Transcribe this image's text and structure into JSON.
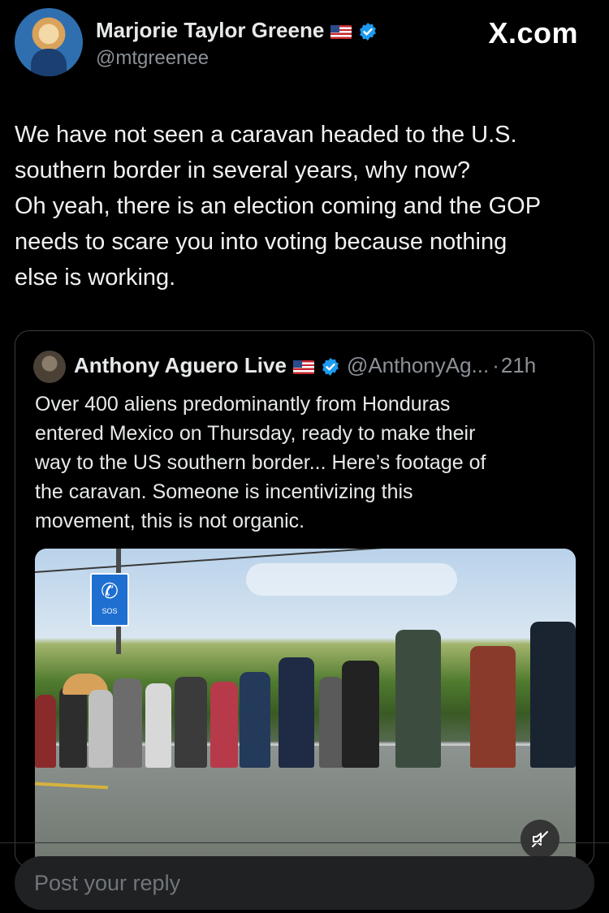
{
  "post": {
    "author_name": "Marjorie Taylor Greene",
    "handle": "@mtgreenee",
    "brand": "X.com",
    "text_lines": [
      "We have not seen a caravan headed to the U.S.",
      "southern border in several years, why now?",
      "Oh yeah, there is an election coming and the GOP",
      "needs to scare you into voting because nothing",
      "else is working."
    ]
  },
  "quote": {
    "author_name": "Anthony Aguero Live",
    "handle": "@AnthonyAg...",
    "separator": "·",
    "time": "21h",
    "text_lines": [
      "Over 400 aliens predominantly from Honduras",
      "entered Mexico on Thursday, ready to make their",
      "way to the US southern border... Here’s footage of",
      "the caravan. Someone is incentivizing this",
      "movement, this is not organic."
    ],
    "sign_text": "SOS"
  },
  "reply": {
    "placeholder": "Post your reply"
  },
  "colors": {
    "background": "#000000",
    "verified_blue": "#1d9bf0",
    "muted_text": "#8b9197"
  },
  "icons": [
    "verified-badge-icon",
    "us-flag-icon",
    "mute-icon"
  ]
}
